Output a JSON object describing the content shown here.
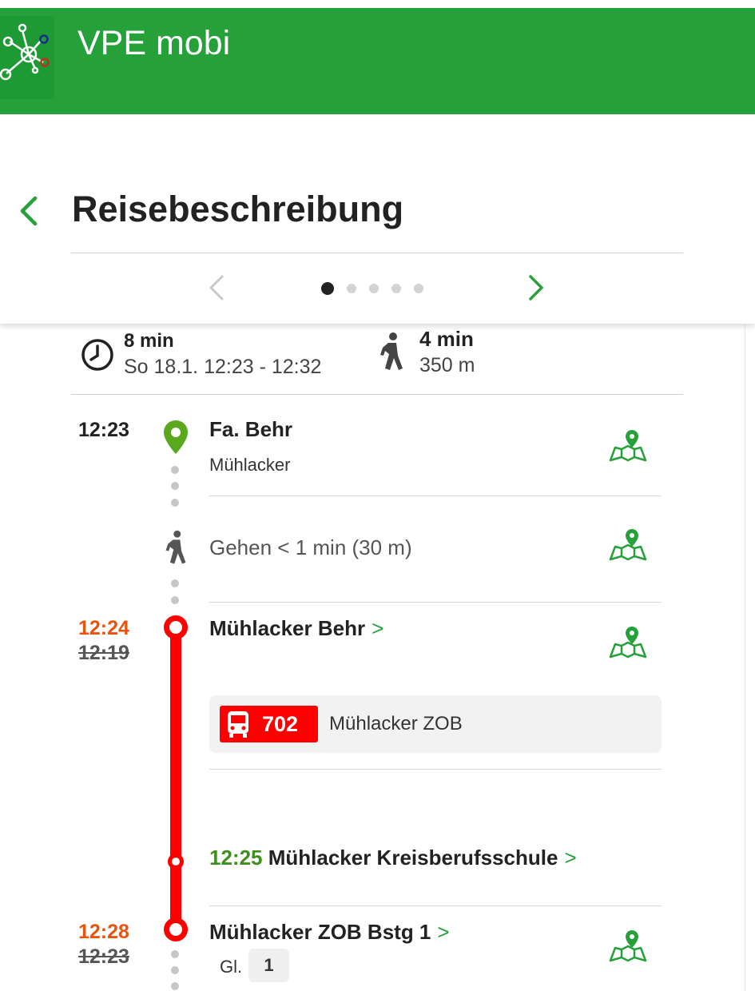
{
  "app": {
    "title": "VPE mobi",
    "brand_color": "#26a13a",
    "logo_icon": "network-nodes-logo"
  },
  "header": {
    "title": "Reisebeschreibung",
    "back_icon": "chevron-left-icon",
    "pager": {
      "total": 5,
      "active": 1
    }
  },
  "summary": {
    "duration": "8 min",
    "date_range": "So 18.1. 12:23 - 12:32",
    "walk_time": "4 min",
    "walk_distance": "350 m"
  },
  "itinerary": {
    "origin": {
      "time": "12:23",
      "name": "Fa. Behr",
      "place": "Mühlacker"
    },
    "walk": {
      "text": "Gehen < 1 min (30 m)"
    },
    "board": {
      "time": "12:24",
      "time_planned": "12:19",
      "name": "Mühlacker Behr",
      "chevron": ">"
    },
    "trip": {
      "mode_icon": "bus-icon",
      "line": "702",
      "line_color": "#ff0000",
      "destination": "Mühlacker ZOB"
    },
    "intermediate": {
      "time": "12:25",
      "name": "Mühlacker Kreisberufsschule",
      "chevron": ">"
    },
    "alight": {
      "time": "12:28",
      "time_planned": "12:23",
      "name": "Mühlacker ZOB Bstg 1",
      "chevron": ">",
      "platform_label": "Gl.",
      "platform": "1"
    }
  },
  "colors": {
    "delay": "#e8530e",
    "intermediate_time": "#3f8f1f",
    "accent": "#26a13a"
  }
}
